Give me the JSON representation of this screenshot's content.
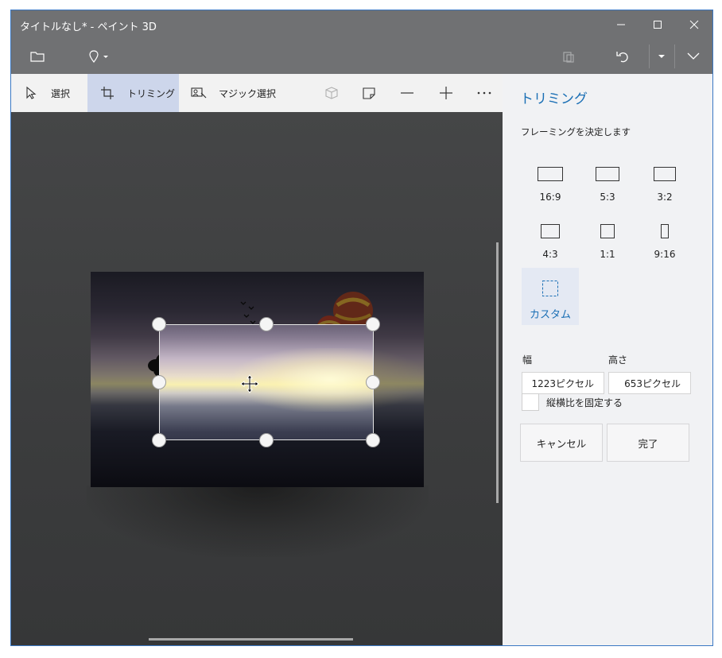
{
  "window": {
    "title": "タイトルなし* - ペイント 3D"
  },
  "titlebar_icons": {
    "minimize": "minimize-icon",
    "maximize": "maximize-icon",
    "close": "close-icon"
  },
  "commandbar": {
    "items": [
      "folder-icon",
      "location-pin-icon",
      "paste-icon",
      "undo-icon",
      "dropdown-icon",
      "expand-icon"
    ]
  },
  "toolbar": {
    "select_label": "選択",
    "crop_label": "トリミング",
    "magic_select_label": "マジック選択",
    "icons": [
      "3d-view-icon",
      "sticker-icon",
      "zoom-out-icon",
      "zoom-in-icon",
      "more-icon"
    ]
  },
  "panel": {
    "title": "トリミング",
    "subtitle": "フレーミングを決定します",
    "ratios": [
      {
        "label": "16:9"
      },
      {
        "label": "5:3"
      },
      {
        "label": "3:2"
      },
      {
        "label": "4:3"
      },
      {
        "label": "1:1"
      },
      {
        "label": "9:16"
      },
      {
        "label": "カスタム"
      }
    ],
    "width_label": "幅",
    "height_label": "高さ",
    "width_value": "1223ピクセル",
    "height_value": "653ピクセル",
    "lock_aspect_label": "縦横比を固定する",
    "cancel_label": "キャンセル",
    "done_label": "完了"
  },
  "colors": {
    "accent": "#1a6fb5",
    "titlebar": "#707173",
    "active_tool": "#cdd6eb"
  }
}
